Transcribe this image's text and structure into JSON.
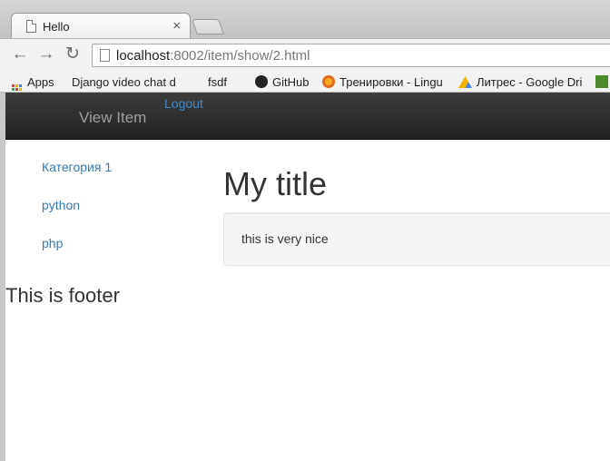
{
  "browser": {
    "tab_title": "Hello",
    "tab_close": "×",
    "url_host": "localhost",
    "url_rest": ":8002/item/show/2.html",
    "nav": {
      "back": "←",
      "forward": "→",
      "reload": "↻"
    }
  },
  "bookmarks": {
    "apps": "Apps",
    "items": [
      {
        "label": "Django video chat d",
        "icon": "page-icon"
      },
      {
        "label": "fsdf",
        "icon": "page-icon"
      },
      {
        "label": "GitHub",
        "icon": "github-icon"
      },
      {
        "label": "Тренировки - Lingu",
        "icon": "lingualeo-icon"
      },
      {
        "label": "Литрес - Google Dri",
        "icon": "google-drive-icon"
      }
    ]
  },
  "navbar": {
    "brand": "View Item",
    "logout": "Logout"
  },
  "sidebar": {
    "links": [
      "Категория 1",
      "python",
      "php"
    ]
  },
  "content": {
    "title": "My title",
    "body": "this is very nice"
  },
  "footer": {
    "text": "This is footer"
  },
  "colors": {
    "link": "#337ab7",
    "navbar": "#222222"
  }
}
